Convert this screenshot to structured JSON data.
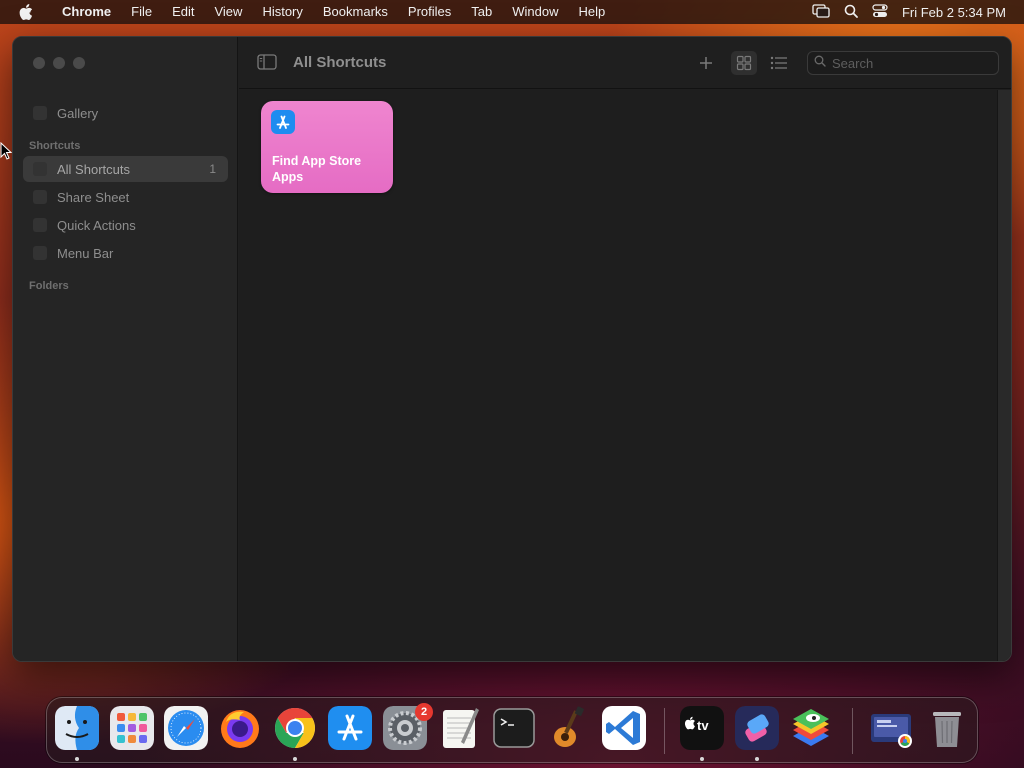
{
  "menubar": {
    "app_name": "Chrome",
    "items": [
      "File",
      "Edit",
      "View",
      "History",
      "Bookmarks",
      "Profiles",
      "Tab",
      "Window",
      "Help"
    ],
    "clock": "Fri Feb 2  5:34 PM"
  },
  "window": {
    "title": "All Shortcuts",
    "search_placeholder": "Search",
    "sidebar": {
      "gallery": "Gallery",
      "shortcuts_header": "Shortcuts",
      "items": [
        {
          "label": "All Shortcuts",
          "count": "1",
          "selected": true
        },
        {
          "label": "Share Sheet"
        },
        {
          "label": "Quick Actions"
        },
        {
          "label": "Menu Bar"
        }
      ],
      "folders_header": "Folders"
    },
    "shortcuts": [
      {
        "title": "Find App Store Apps",
        "icon": "app-store-icon",
        "color": "#e96fc8"
      }
    ]
  },
  "dock": {
    "apps": [
      "finder",
      "launchpad",
      "safari",
      "firefox",
      "chrome",
      "app-store",
      "system-settings",
      "textedit",
      "terminal",
      "garageband",
      "vscode",
      "apple-tv",
      "shortcuts",
      "bluestacks",
      "screen-recorder",
      "trash"
    ],
    "system_settings_badge": "2"
  },
  "colors": {
    "accent_tile": "#e96fc8",
    "window_bg": "#1f1f1f",
    "sidebar_bg": "#252525"
  }
}
